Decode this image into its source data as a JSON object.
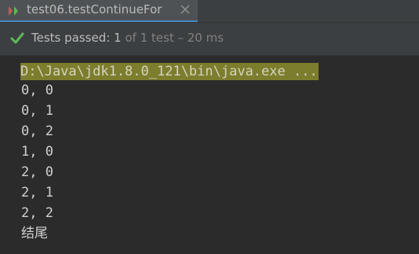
{
  "tab": {
    "title": "test06.testContinueFor",
    "close_icon": "close-icon",
    "run_icon": "run-config-icon"
  },
  "status": {
    "icon": "check-icon",
    "label": "Tests passed: ",
    "count": "1",
    "detail": " of 1 test – 20 ms"
  },
  "console": {
    "command": "D:\\Java\\jdk1.8.0_121\\bin\\java.exe ...",
    "lines": [
      "0, 0",
      "0, 1",
      "0, 2",
      "1, 0",
      "2, 0",
      "2, 1",
      "2, 2",
      "结尾"
    ]
  },
  "colors": {
    "tab_underline": "#4a88c7",
    "check": "#5fb85a",
    "command_highlight": "#7d7d2e"
  }
}
